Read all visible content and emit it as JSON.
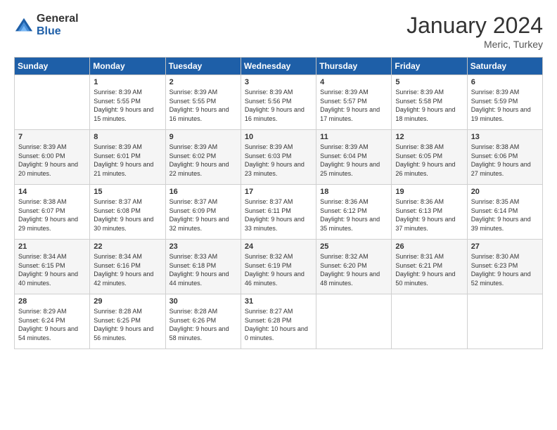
{
  "header": {
    "logo_general": "General",
    "logo_blue": "Blue",
    "month_title": "January 2024",
    "location": "Meric, Turkey"
  },
  "weekdays": [
    "Sunday",
    "Monday",
    "Tuesday",
    "Wednesday",
    "Thursday",
    "Friday",
    "Saturday"
  ],
  "weeks": [
    [
      {
        "day": "",
        "sunrise": "",
        "sunset": "",
        "daylight": ""
      },
      {
        "day": "1",
        "sunrise": "Sunrise: 8:39 AM",
        "sunset": "Sunset: 5:55 PM",
        "daylight": "Daylight: 9 hours and 15 minutes."
      },
      {
        "day": "2",
        "sunrise": "Sunrise: 8:39 AM",
        "sunset": "Sunset: 5:55 PM",
        "daylight": "Daylight: 9 hours and 16 minutes."
      },
      {
        "day": "3",
        "sunrise": "Sunrise: 8:39 AM",
        "sunset": "Sunset: 5:56 PM",
        "daylight": "Daylight: 9 hours and 16 minutes."
      },
      {
        "day": "4",
        "sunrise": "Sunrise: 8:39 AM",
        "sunset": "Sunset: 5:57 PM",
        "daylight": "Daylight: 9 hours and 17 minutes."
      },
      {
        "day": "5",
        "sunrise": "Sunrise: 8:39 AM",
        "sunset": "Sunset: 5:58 PM",
        "daylight": "Daylight: 9 hours and 18 minutes."
      },
      {
        "day": "6",
        "sunrise": "Sunrise: 8:39 AM",
        "sunset": "Sunset: 5:59 PM",
        "daylight": "Daylight: 9 hours and 19 minutes."
      }
    ],
    [
      {
        "day": "7",
        "sunrise": "Sunrise: 8:39 AM",
        "sunset": "Sunset: 6:00 PM",
        "daylight": "Daylight: 9 hours and 20 minutes."
      },
      {
        "day": "8",
        "sunrise": "Sunrise: 8:39 AM",
        "sunset": "Sunset: 6:01 PM",
        "daylight": "Daylight: 9 hours and 21 minutes."
      },
      {
        "day": "9",
        "sunrise": "Sunrise: 8:39 AM",
        "sunset": "Sunset: 6:02 PM",
        "daylight": "Daylight: 9 hours and 22 minutes."
      },
      {
        "day": "10",
        "sunrise": "Sunrise: 8:39 AM",
        "sunset": "Sunset: 6:03 PM",
        "daylight": "Daylight: 9 hours and 23 minutes."
      },
      {
        "day": "11",
        "sunrise": "Sunrise: 8:39 AM",
        "sunset": "Sunset: 6:04 PM",
        "daylight": "Daylight: 9 hours and 25 minutes."
      },
      {
        "day": "12",
        "sunrise": "Sunrise: 8:38 AM",
        "sunset": "Sunset: 6:05 PM",
        "daylight": "Daylight: 9 hours and 26 minutes."
      },
      {
        "day": "13",
        "sunrise": "Sunrise: 8:38 AM",
        "sunset": "Sunset: 6:06 PM",
        "daylight": "Daylight: 9 hours and 27 minutes."
      }
    ],
    [
      {
        "day": "14",
        "sunrise": "Sunrise: 8:38 AM",
        "sunset": "Sunset: 6:07 PM",
        "daylight": "Daylight: 9 hours and 29 minutes."
      },
      {
        "day": "15",
        "sunrise": "Sunrise: 8:37 AM",
        "sunset": "Sunset: 6:08 PM",
        "daylight": "Daylight: 9 hours and 30 minutes."
      },
      {
        "day": "16",
        "sunrise": "Sunrise: 8:37 AM",
        "sunset": "Sunset: 6:09 PM",
        "daylight": "Daylight: 9 hours and 32 minutes."
      },
      {
        "day": "17",
        "sunrise": "Sunrise: 8:37 AM",
        "sunset": "Sunset: 6:11 PM",
        "daylight": "Daylight: 9 hours and 33 minutes."
      },
      {
        "day": "18",
        "sunrise": "Sunrise: 8:36 AM",
        "sunset": "Sunset: 6:12 PM",
        "daylight": "Daylight: 9 hours and 35 minutes."
      },
      {
        "day": "19",
        "sunrise": "Sunrise: 8:36 AM",
        "sunset": "Sunset: 6:13 PM",
        "daylight": "Daylight: 9 hours and 37 minutes."
      },
      {
        "day": "20",
        "sunrise": "Sunrise: 8:35 AM",
        "sunset": "Sunset: 6:14 PM",
        "daylight": "Daylight: 9 hours and 39 minutes."
      }
    ],
    [
      {
        "day": "21",
        "sunrise": "Sunrise: 8:34 AM",
        "sunset": "Sunset: 6:15 PM",
        "daylight": "Daylight: 9 hours and 40 minutes."
      },
      {
        "day": "22",
        "sunrise": "Sunrise: 8:34 AM",
        "sunset": "Sunset: 6:16 PM",
        "daylight": "Daylight: 9 hours and 42 minutes."
      },
      {
        "day": "23",
        "sunrise": "Sunrise: 8:33 AM",
        "sunset": "Sunset: 6:18 PM",
        "daylight": "Daylight: 9 hours and 44 minutes."
      },
      {
        "day": "24",
        "sunrise": "Sunrise: 8:32 AM",
        "sunset": "Sunset: 6:19 PM",
        "daylight": "Daylight: 9 hours and 46 minutes."
      },
      {
        "day": "25",
        "sunrise": "Sunrise: 8:32 AM",
        "sunset": "Sunset: 6:20 PM",
        "daylight": "Daylight: 9 hours and 48 minutes."
      },
      {
        "day": "26",
        "sunrise": "Sunrise: 8:31 AM",
        "sunset": "Sunset: 6:21 PM",
        "daylight": "Daylight: 9 hours and 50 minutes."
      },
      {
        "day": "27",
        "sunrise": "Sunrise: 8:30 AM",
        "sunset": "Sunset: 6:23 PM",
        "daylight": "Daylight: 9 hours and 52 minutes."
      }
    ],
    [
      {
        "day": "28",
        "sunrise": "Sunrise: 8:29 AM",
        "sunset": "Sunset: 6:24 PM",
        "daylight": "Daylight: 9 hours and 54 minutes."
      },
      {
        "day": "29",
        "sunrise": "Sunrise: 8:28 AM",
        "sunset": "Sunset: 6:25 PM",
        "daylight": "Daylight: 9 hours and 56 minutes."
      },
      {
        "day": "30",
        "sunrise": "Sunrise: 8:28 AM",
        "sunset": "Sunset: 6:26 PM",
        "daylight": "Daylight: 9 hours and 58 minutes."
      },
      {
        "day": "31",
        "sunrise": "Sunrise: 8:27 AM",
        "sunset": "Sunset: 6:28 PM",
        "daylight": "Daylight: 10 hours and 0 minutes."
      },
      {
        "day": "",
        "sunrise": "",
        "sunset": "",
        "daylight": ""
      },
      {
        "day": "",
        "sunrise": "",
        "sunset": "",
        "daylight": ""
      },
      {
        "day": "",
        "sunrise": "",
        "sunset": "",
        "daylight": ""
      }
    ]
  ]
}
